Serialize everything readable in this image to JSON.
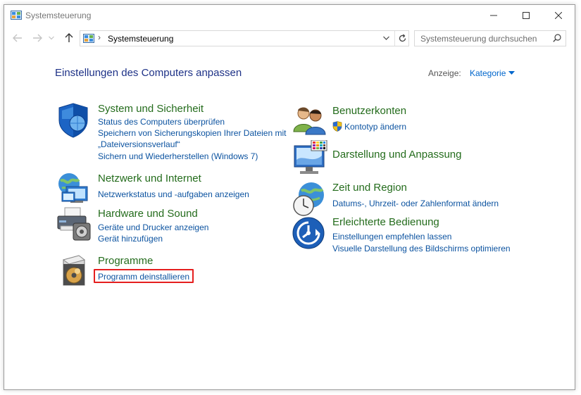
{
  "window": {
    "title": "Systemsteuerung"
  },
  "address": {
    "path": "Systemsteuerung"
  },
  "search": {
    "placeholder": "Systemsteuerung durchsuchen"
  },
  "main": {
    "heading": "Einstellungen des Computers anpassen",
    "view_label": "Anzeige:",
    "view_value": "Kategorie"
  },
  "categories": {
    "system": {
      "title": "System und Sicherheit",
      "links": [
        "Status des Computers überprüfen",
        "Speichern von Sicherungskopien Ihrer Dateien mit",
        "„Dateiversionsverlauf“",
        "Sichern und Wiederherstellen (Windows 7)"
      ]
    },
    "network": {
      "title": "Netzwerk und Internet",
      "links": [
        "Netzwerkstatus und -aufgaben anzeigen"
      ]
    },
    "hardware": {
      "title": "Hardware und Sound",
      "links": [
        "Geräte und Drucker anzeigen",
        "Gerät hinzufügen"
      ]
    },
    "programs": {
      "title": "Programme",
      "links": [
        "Programm deinstallieren"
      ]
    },
    "users": {
      "title": "Benutzerkonten",
      "links": [
        "Kontotyp ändern"
      ]
    },
    "appearance": {
      "title": "Darstellung und Anpassung"
    },
    "clock": {
      "title": "Zeit und Region",
      "links": [
        "Datums-, Uhrzeit- oder Zahlenformat ändern"
      ]
    },
    "access": {
      "title": "Erleichterte Bedienung",
      "links": [
        "Einstellungen empfehlen lassen",
        "Visuelle Darstellung des Bildschirms optimieren"
      ]
    }
  },
  "colors": {
    "heading": "#1e3287",
    "category_title": "#246c1c",
    "link": "#0c53a0",
    "highlight": "#e51f1f"
  },
  "icons": [
    "control-panel-icon",
    "back-arrow-icon",
    "forward-arrow-icon",
    "up-arrow-icon",
    "refresh-icon",
    "search-icon",
    "shield-icon",
    "network-globe-icon",
    "printer-icon",
    "programs-disc-icon",
    "users-icon",
    "uac-shield-icon",
    "monitor-palette-icon",
    "clock-globe-icon",
    "ease-of-access-icon"
  ]
}
